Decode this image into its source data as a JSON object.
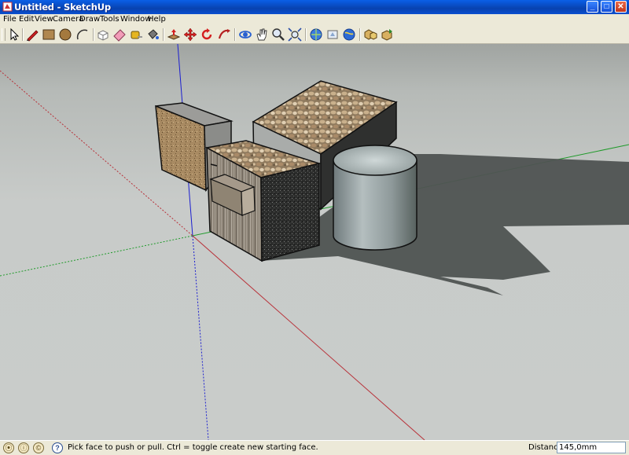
{
  "window": {
    "title": "Untitled - SketchUp",
    "app_icon": "sketchup-logo-icon",
    "controls": [
      "minimize",
      "maximize",
      "close"
    ],
    "control_glyphs": {
      "minimize": "_",
      "maximize": "□",
      "close": "✕"
    }
  },
  "menu": [
    "File",
    "Edit",
    "View",
    "Camera",
    "Draw",
    "Tools",
    "Window",
    "Help"
  ],
  "toolbar": {
    "tools": [
      {
        "name": "select-tool-icon"
      },
      {
        "name": "pencil-line-tool-icon"
      },
      {
        "name": "rectangle-tool-icon"
      },
      {
        "name": "circle-tool-icon"
      },
      {
        "name": "arc-tool-icon"
      },
      {
        "name": "make-component-tool-icon"
      },
      {
        "name": "eraser-tool-icon"
      },
      {
        "name": "tape-measure-tool-icon"
      },
      {
        "name": "paint-bucket-tool-icon"
      },
      {
        "name": "push-pull-tool-icon",
        "active": true
      },
      {
        "name": "move-tool-icon"
      },
      {
        "name": "rotate-tool-icon"
      },
      {
        "name": "follow-me-tool-icon"
      },
      {
        "name": "orbit-tool-icon"
      },
      {
        "name": "pan-tool-icon"
      },
      {
        "name": "zoom-tool-icon"
      },
      {
        "name": "zoom-extents-tool-icon"
      },
      {
        "name": "get-models-icon"
      },
      {
        "name": "share-model-icon"
      },
      {
        "name": "google-earth-icon"
      },
      {
        "name": "components-icon"
      },
      {
        "name": "share-component-icon"
      }
    ]
  },
  "status": {
    "message": "Pick face to push or pull.  Ctrl = toggle create new starting face.",
    "distance_label": "Distance",
    "distance_value": "145,0mm",
    "icons": [
      "geo-location-icon",
      "credits-icon",
      "user-icon",
      "help-icon"
    ],
    "icon_glyphs": [
      "⦿",
      "ⓘ",
      "©",
      "?"
    ]
  },
  "colors": {
    "title_bar": "#0a5fe8",
    "chrome": "#ece9d8",
    "sky": "#a0a4a1",
    "ground": "#c9ccca",
    "axis_red": "#b8323a",
    "axis_green": "#1f9a2a",
    "axis_blue": "#1b1ed0",
    "shadow": "#4f5352"
  }
}
